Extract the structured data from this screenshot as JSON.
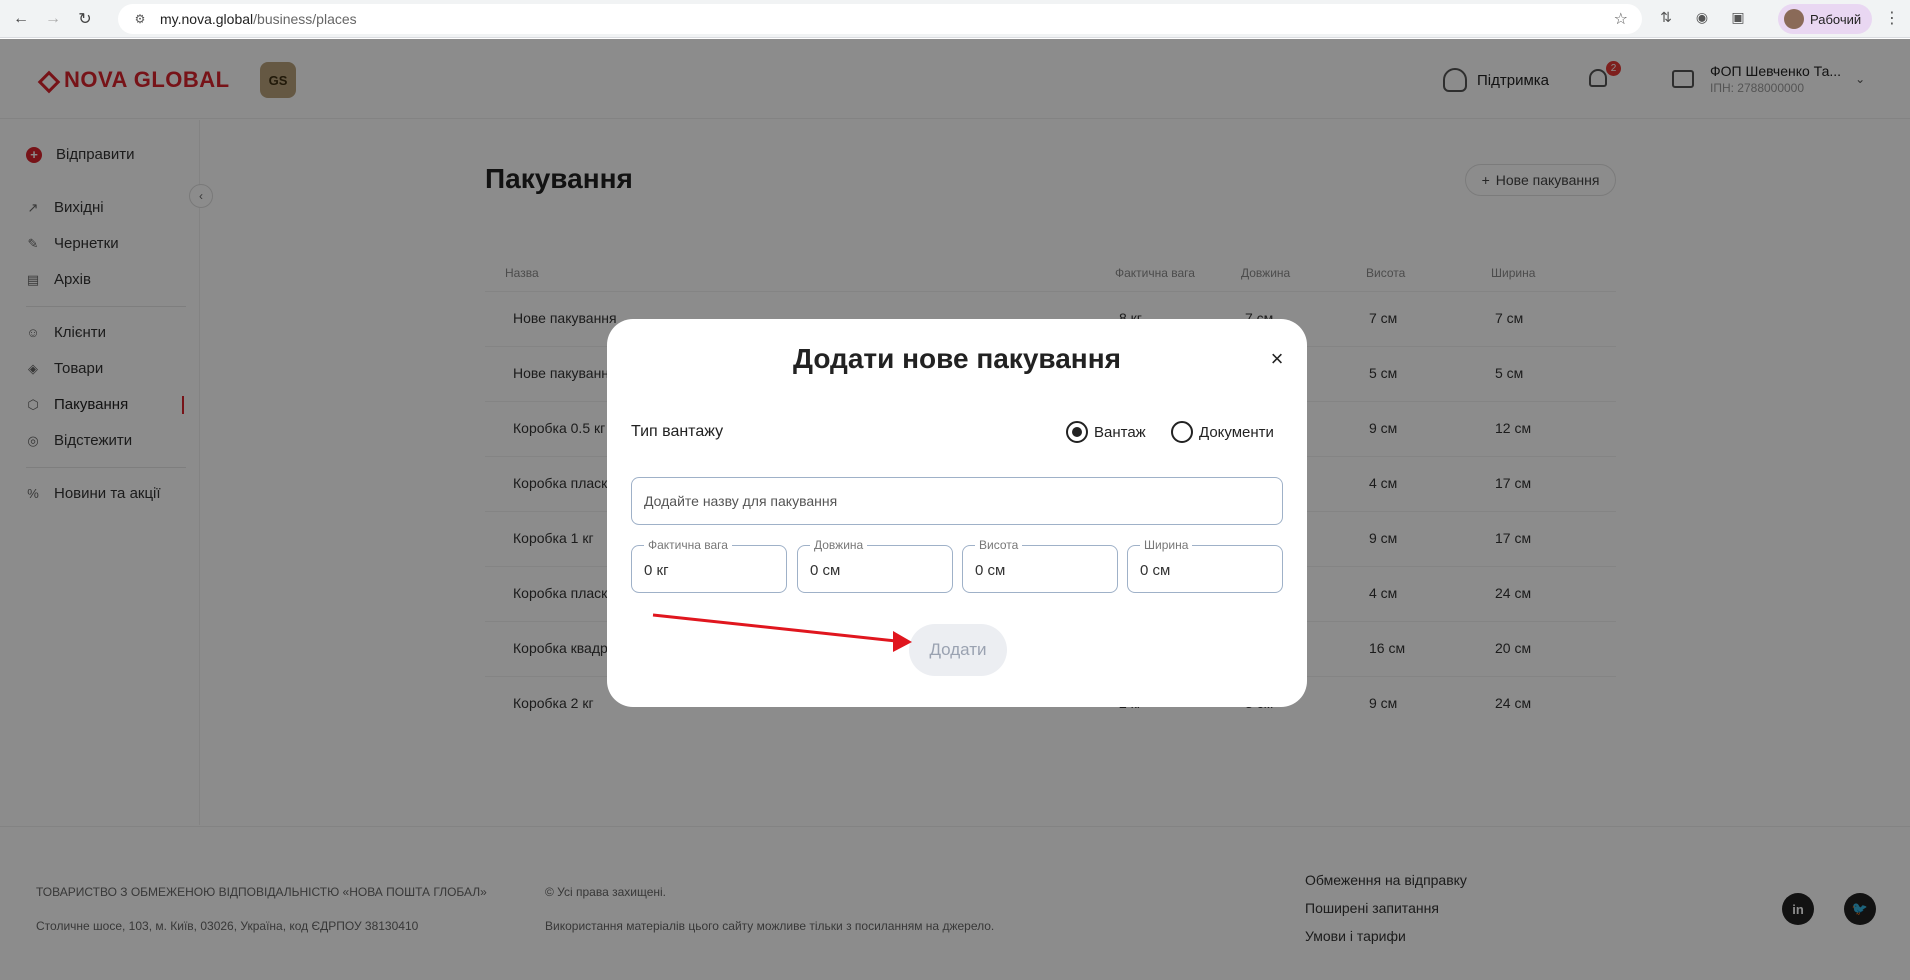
{
  "browser": {
    "url_host": "my.nova.global",
    "url_path": "/business/places",
    "profile_label": "Рабочий"
  },
  "header": {
    "logo_text": "NOVA GLOBAL",
    "badge_text": "GS",
    "support_label": "Підтримка",
    "notifications_count": "2",
    "account_name": "ФОП Шевченко Та...",
    "account_ipn": "ІПН: 2788000000"
  },
  "sidebar": {
    "send": "Відправити",
    "outgoing": "Вихідні",
    "drafts": "Чернетки",
    "archive": "Архів",
    "clients": "Клієнти",
    "goods": "Товари",
    "packaging": "Пакування",
    "tracking": "Відстежити",
    "news": "Новини та акції"
  },
  "main": {
    "title": "Пакування",
    "new_button": "Нове пакування",
    "columns": [
      "Назва",
      "Фактична вага",
      "Довжина",
      "Висота",
      "Ширина"
    ],
    "rows": [
      {
        "name": "Нове пакування",
        "weight": "8 кг",
        "length": "7 см",
        "height": "7 см",
        "width": "7 см"
      },
      {
        "name": "Нове пакування",
        "weight": "",
        "length": "",
        "height": "5 см",
        "width": "5 см"
      },
      {
        "name": "Коробка 0.5 кг",
        "weight": "",
        "length": "",
        "height": "9 см",
        "width": "12 см"
      },
      {
        "name": "Коробка пласк",
        "weight": "",
        "length": "",
        "height": "4 см",
        "width": "17 см"
      },
      {
        "name": "Коробка 1 кг",
        "weight": "",
        "length": "",
        "height": "9 см",
        "width": "17 см"
      },
      {
        "name": "Коробка пласк",
        "weight": "",
        "length": "",
        "height": "4 см",
        "width": "24 см"
      },
      {
        "name": "Коробка квадр",
        "weight": "",
        "length": "",
        "height": "16 см",
        "width": "20 см"
      },
      {
        "name": "Коробка 2 кг",
        "weight": "2 кг",
        "length": "3 см",
        "height": "9 см",
        "width": "24 см"
      }
    ]
  },
  "footer": {
    "company": "ТОВАРИСТВО З ОБМЕЖЕНОЮ ВІДПОВІДАЛЬНІСТЮ «НОВА ПОШТА ГЛОБАЛ»",
    "address": "Столичне шосе, 103, м. Київ, 03026, Україна, код ЄДРПОУ 38130410",
    "rights": "© Усі права захищені.",
    "usage": "Використання матеріалів цього сайту можливе тільки з посиланням на джерело.",
    "link_restrictions": "Обмеження на відправку",
    "link_faq": "Поширені запитання",
    "link_terms": "Умови і тарифи",
    "linkedin": "in"
  },
  "modal": {
    "title": "Додати нове пакування",
    "close": "×",
    "cargo_type_label": "Тип вантажу",
    "radio_cargo": "Вантаж",
    "radio_documents": "Документи",
    "name_placeholder": "Додайте назву для пакування",
    "weight_label": "Фактична вага",
    "weight_value": "0 кг",
    "length_label": "Довжина",
    "length_value": "0 см",
    "height_label": "Висота",
    "height_value": "0 см",
    "width_label": "Ширина",
    "width_value": "0 см",
    "add_button": "Додати"
  },
  "colors": {
    "brand_red": "#d9232d",
    "annotation_arrow": "#e0161e"
  }
}
